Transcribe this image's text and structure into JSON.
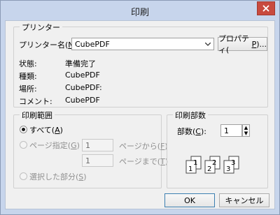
{
  "window": {
    "title": "印刷"
  },
  "printer": {
    "group_title": "プリンター",
    "name_label_pre": "プリンター名(",
    "name_label_key": "N",
    "name_label_post": "):",
    "selected_printer": "CubePDF",
    "properties_pre": "プロパティ(",
    "properties_key": "P",
    "properties_post": ")...",
    "rows": [
      {
        "label": "状態:",
        "value": "準備完了"
      },
      {
        "label": "種類:",
        "value": "CubePDF"
      },
      {
        "label": "場所:",
        "value": "CubePDF:"
      },
      {
        "label": "コメント:",
        "value": "CubePDF"
      }
    ]
  },
  "range": {
    "group_title": "印刷範囲",
    "all_pre": "すべて(",
    "all_key": "A",
    "all_post": ")",
    "pages_pre": "ページ指定(",
    "pages_key": "G",
    "pages_post": ")",
    "from_value": "1",
    "to_value": "1",
    "from_label_pre": "ページから(",
    "from_label_key": "F",
    "from_label_post": ")",
    "to_label_pre": "ページまで(",
    "to_label_key": "T",
    "to_label_post": ")",
    "selection_pre": "選択した部分(",
    "selection_key": "S",
    "selection_post": ")"
  },
  "copies": {
    "group_title": "印刷部数",
    "label_pre": "部数(",
    "label_key": "C",
    "label_post": "):",
    "value": "1",
    "collate_labels": [
      "1",
      "1",
      "2",
      "2",
      "3",
      "3"
    ]
  },
  "buttons": {
    "ok": "OK",
    "cancel": "キャンセル"
  }
}
